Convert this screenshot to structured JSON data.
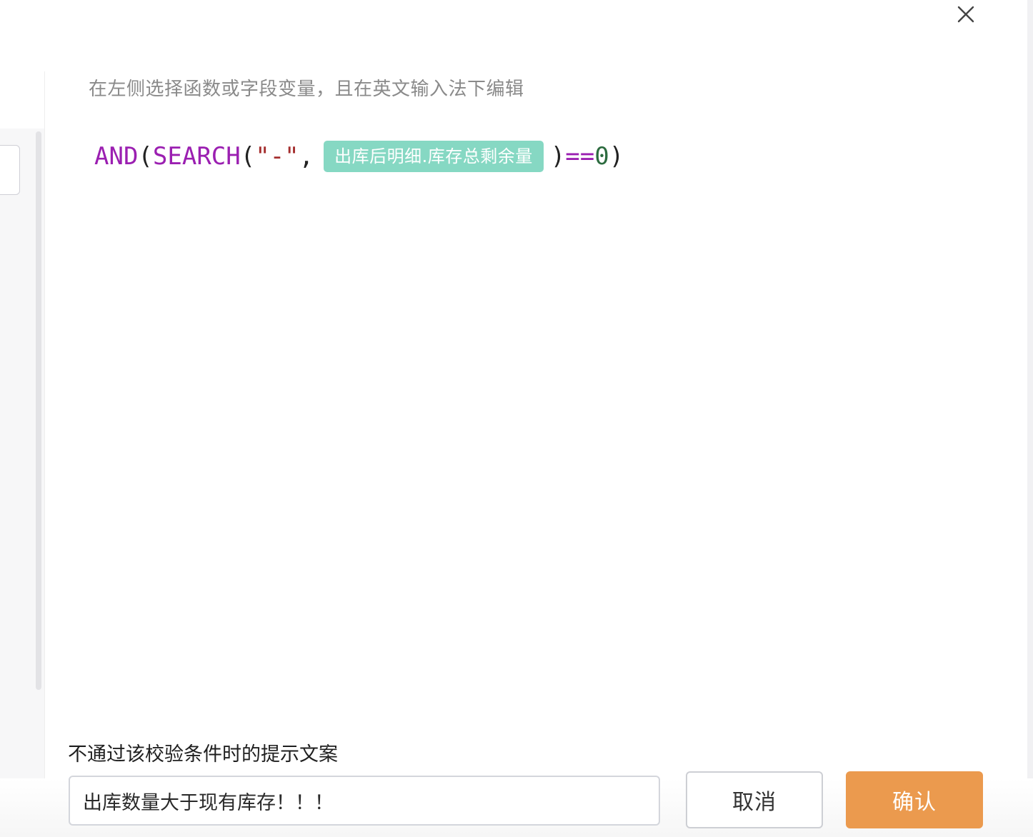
{
  "dialog": {
    "close_icon": "close-icon"
  },
  "editor": {
    "hint": "在左侧选择函数或字段变量，且在英文输入法下编辑",
    "formula": {
      "fn_and": "AND",
      "open1": "(",
      "fn_search": "SEARCH",
      "open2": "(",
      "string_literal": "\"-\"",
      "comma": ",",
      "field_tag": "出库后明细.库存总剩余量",
      "close2": ")",
      "operator": "==",
      "number": "0",
      "close1": ")"
    },
    "colors": {
      "function": "#9b1fb1",
      "string": "#a42d2d",
      "number": "#2c6b3f",
      "field_tag_bg": "#86d8c3"
    }
  },
  "message": {
    "label": "不通过该校验条件时的提示文案",
    "value": "出库数量大于现有库存！！！"
  },
  "actions": {
    "cancel_label": "取消",
    "confirm_label": "确认",
    "confirm_color": "#eb9a4e"
  }
}
